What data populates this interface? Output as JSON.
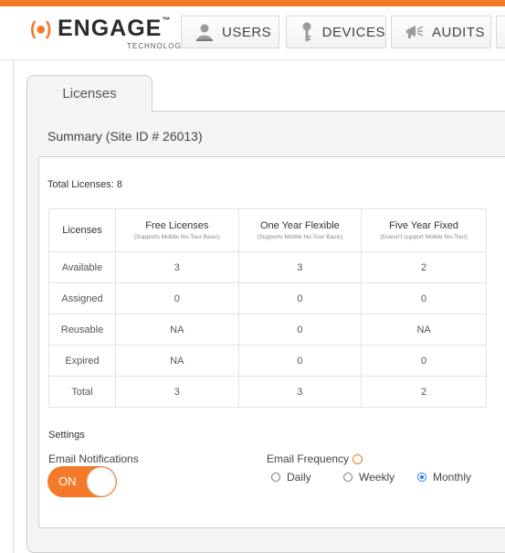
{
  "header": {
    "logo": {
      "signal": "(●)",
      "name": "ENGAGE",
      "tm": "™",
      "sub": "TECHNOLOGY"
    },
    "nav": [
      {
        "label": "USERS",
        "icon": "user-icon"
      },
      {
        "label": "DEVICES",
        "icon": "key-icon"
      },
      {
        "label": "AUDITS",
        "icon": "megaphone-icon"
      }
    ]
  },
  "tab": {
    "label": "Licenses"
  },
  "summary": {
    "title": "Summary (Site ID # 26013)"
  },
  "licenses": {
    "total_text": "Total Licenses: 8",
    "columns": [
      {
        "title": "Licenses",
        "sub": ""
      },
      {
        "title": "Free Licenses",
        "sub": "(Supports Mobile No-Tour Basic)"
      },
      {
        "title": "One Year Flexible",
        "sub": "(Supports Mobile No-Tour Basic)"
      },
      {
        "title": "Five Year Fixed",
        "sub": "(Doesn't support Mobile No-Tour)"
      }
    ],
    "rows": [
      {
        "label": "Available",
        "cells": [
          "3",
          "3",
          "2"
        ]
      },
      {
        "label": "Assigned",
        "cells": [
          "0",
          "0",
          "0"
        ]
      },
      {
        "label": "Reusable",
        "cells": [
          "NA",
          "0",
          "NA"
        ]
      },
      {
        "label": "Expired",
        "cells": [
          "NA",
          "0",
          "0"
        ]
      },
      {
        "label": "Total",
        "cells": [
          "3",
          "3",
          "2"
        ]
      }
    ]
  },
  "settings": {
    "title": "Settings",
    "email_notifications_label": "Email Notifications",
    "toggle_label": "ON",
    "toggle_state": "on",
    "email_frequency_label": "Email Frequency",
    "frequency_options": [
      "Daily",
      "Weekly",
      "Monthly"
    ],
    "frequency_selected": "Monthly"
  },
  "colors": {
    "accent": "#f47a2a",
    "radio_selected": "#1e7de6"
  }
}
